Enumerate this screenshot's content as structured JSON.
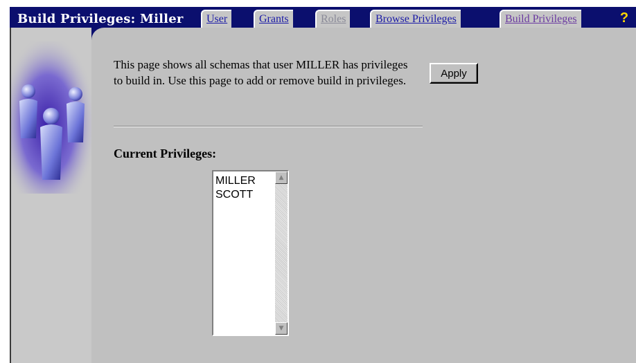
{
  "header": {
    "title": "Build Privileges: Miller",
    "help_label": "?"
  },
  "tabs": [
    {
      "label": "User",
      "state": "link"
    },
    {
      "label": "Grants",
      "state": "link"
    },
    {
      "label": "Roles",
      "state": "disabled"
    },
    {
      "label": "Browse Privileges",
      "state": "link"
    },
    {
      "label": "Build Privileges",
      "state": "active"
    }
  ],
  "main": {
    "description": "This page shows all schemas that user MILLER has privileges to build in. Use this page to add or remove build in privileges.",
    "apply_label": "Apply",
    "current_privileges_label": "Current Privileges:",
    "privileges": [
      "MILLER",
      "SCOTT"
    ]
  },
  "icons": {
    "side": "people-group-icon",
    "scroll_up": "scroll-up-arrow-icon",
    "scroll_down": "scroll-down-arrow-icon"
  },
  "colors": {
    "frame": "#0b0f6e",
    "panel": "#c0c0c0",
    "link": "#1a1aa6",
    "help": "#ffd800"
  }
}
